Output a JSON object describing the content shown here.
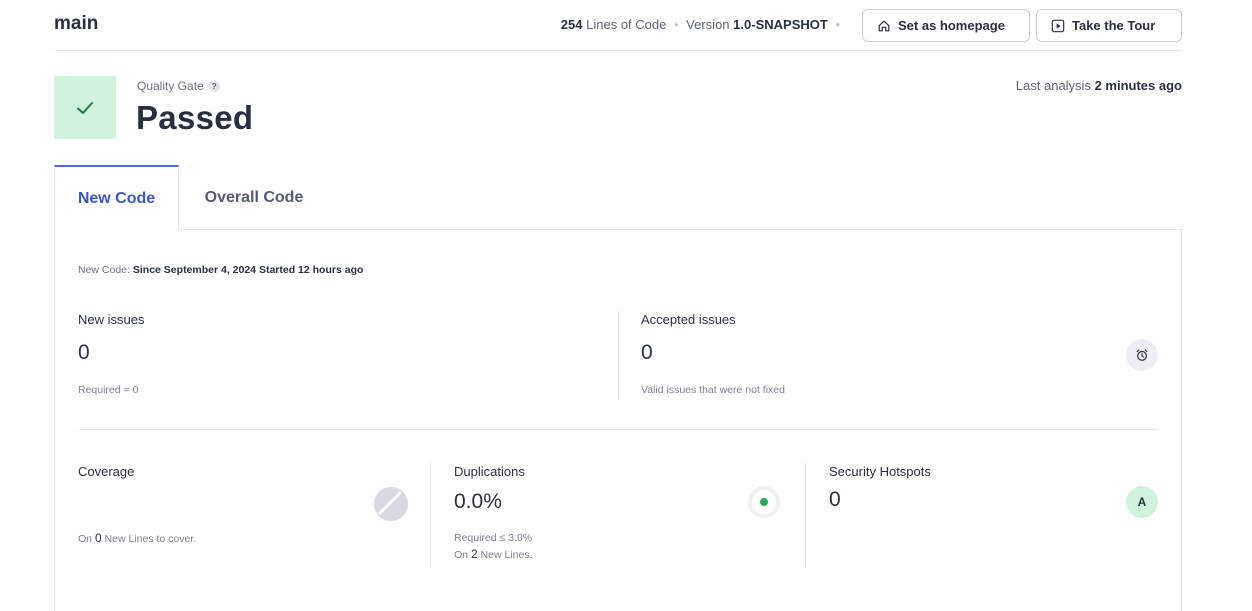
{
  "header": {
    "branch": "main",
    "lines_of_code_value": "254",
    "lines_of_code_label": "Lines of Code",
    "version_label": "Version",
    "version_value": "1.0-SNAPSHOT",
    "set_homepage_label": "Set as homepage",
    "take_tour_label": "Take the Tour"
  },
  "quality_gate": {
    "label": "Quality Gate",
    "status": "Passed",
    "last_analysis_label": "Last analysis",
    "last_analysis_value": "2 minutes ago"
  },
  "tabs": [
    {
      "label": "New Code",
      "active": true
    },
    {
      "label": "Overall Code",
      "active": false
    }
  ],
  "new_code": {
    "since_prefix": "New Code:",
    "since_value": "Since September 4, 2024",
    "started": "Started 12 hours ago"
  },
  "metrics": {
    "new_issues": {
      "title": "New issues",
      "value": "0",
      "sub": "Required = 0"
    },
    "accepted_issues": {
      "title": "Accepted issues",
      "value": "0",
      "sub": "Valid issues that were not fixed"
    },
    "coverage": {
      "title": "Coverage",
      "sub_prefix": "On",
      "sub_value": "0",
      "sub_suffix": "New Lines to cover."
    },
    "duplications": {
      "title": "Duplications",
      "value": "0.0%",
      "sub1": "Required ≤ 3.0%",
      "sub2_prefix": "On",
      "sub2_value": "2",
      "sub2_suffix": "New Lines."
    },
    "security_hotspots": {
      "title": "Security Hotspots",
      "value": "0",
      "rating": "A"
    }
  },
  "colors": {
    "accent": "#4e6ae2",
    "passed_bg": "#d1f2dc",
    "passed_check": "#1c7a45",
    "dup_dot": "#1fad5b"
  },
  "icons": [
    "home-icon",
    "play-icon",
    "check-icon",
    "help-icon",
    "alarm-clock-icon",
    "coverage-pie-icon",
    "duplication-dot-icon"
  ]
}
